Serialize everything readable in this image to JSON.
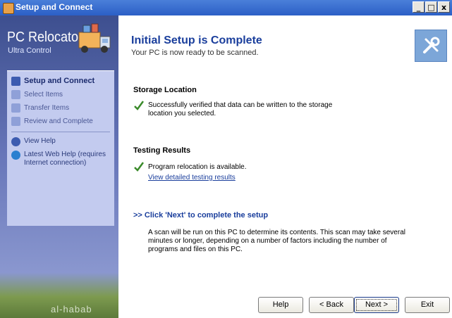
{
  "window": {
    "title": "Setup and Connect",
    "controls": {
      "minimize": "_",
      "maximize": "□",
      "close": "x"
    }
  },
  "sidebar": {
    "product_name": "PC Relocator",
    "product_edition": "Ultra Control",
    "steps": [
      {
        "label": "Setup and Connect",
        "icon": "tools-icon",
        "active": true
      },
      {
        "label": "Select Items",
        "icon": "select-items-icon",
        "active": false
      },
      {
        "label": "Transfer Items",
        "icon": "transfer-arrow-icon",
        "active": false
      },
      {
        "label": "Review and Complete",
        "icon": "review-icon",
        "active": false
      }
    ],
    "help_links": [
      {
        "label": "View Help",
        "icon": "help-icon"
      },
      {
        "label": "Latest Web Help (requires Internet connection)",
        "icon": "globe-icon"
      }
    ],
    "watermark": "al-habab"
  },
  "header": {
    "title": "Initial Setup is Complete",
    "subtitle": "Your PC is now ready to be scanned."
  },
  "storage": {
    "title": "Storage Location",
    "message_line1": "Successfully verified that data can be written to the storage",
    "message_line2": "location you selected."
  },
  "testing": {
    "title": "Testing Results",
    "message": "Program relocation is available.",
    "link": "View detailed testing results"
  },
  "next_step": {
    "title": ">> Click 'Next' to complete the setup",
    "line1": "A scan will be run on this PC to determine its contents.  This scan may take several",
    "line2": "minutes or longer, depending on a number of factors including the number of",
    "line3": "programs and files on this PC."
  },
  "buttons": {
    "help": "Help",
    "back": "< Back",
    "next": "Next >",
    "exit": "Exit"
  },
  "colors": {
    "accent": "#1a3e9c",
    "check": "#3a8a2a",
    "sidebar_panel": "#c3cbef"
  }
}
